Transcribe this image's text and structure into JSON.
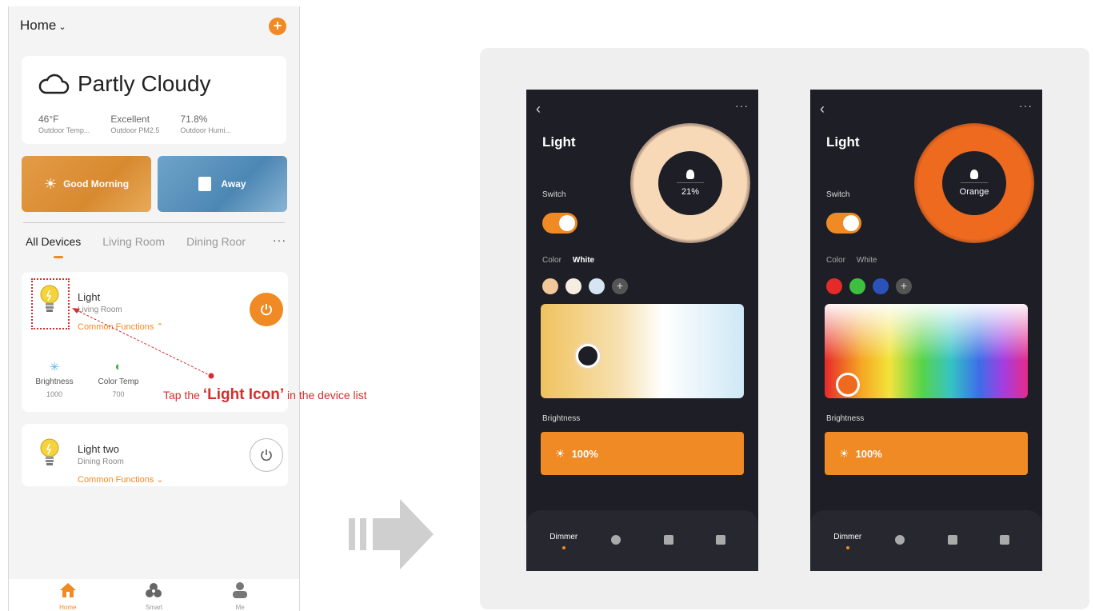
{
  "home": {
    "title": "Home",
    "add_icon": "plus-icon"
  },
  "weather": {
    "condition": "Partly Cloudy",
    "stats": [
      {
        "value": "46°F",
        "label": "Outdoor Temp..."
      },
      {
        "value": "Excellent",
        "label": "Outdoor PM2.5"
      },
      {
        "value": "71.8%",
        "label": "Outdoor Humi..."
      }
    ]
  },
  "scenes": [
    {
      "label": "Good Morning",
      "icon": "sun-icon"
    },
    {
      "label": "Away",
      "icon": "door-icon"
    }
  ],
  "tabs": [
    "All Devices",
    "Living Room",
    "Dining Roor"
  ],
  "tabs_more": "···",
  "devices": [
    {
      "name": "Light",
      "room": "Living Room",
      "functions_label": "Common Functions ⌃",
      "power": "on",
      "functions": [
        {
          "label": "Brightness",
          "value": "1000",
          "icon": "brightness-icon"
        },
        {
          "label": "Color Temp",
          "value": "700",
          "icon": "color-temp-icon"
        }
      ]
    },
    {
      "name": "Light two",
      "room": "Dining Room",
      "functions_label": "Common Functions ⌄",
      "power": "off"
    }
  ],
  "annotation": {
    "prefix": "Tap the ",
    "highlight": "‘Light Icon’",
    "suffix": " in the device list"
  },
  "bottom_nav": [
    {
      "label": "Home",
      "icon": "home-icon",
      "active": true
    },
    {
      "label": "Smart",
      "icon": "smart-icon",
      "active": false
    },
    {
      "label": "Me",
      "icon": "user-icon",
      "active": false
    }
  ],
  "detail_screens": [
    {
      "title": "Light",
      "switch_label": "Switch",
      "ring_value": "21%",
      "ring_color": "#f7d9b8",
      "color_tab": "Color",
      "white_tab": "White",
      "active_tab": "White",
      "swatches": [
        "#f2c79a",
        "#f5ece2",
        "#d6e4f3"
      ],
      "brightness_label": "Brightness",
      "brightness_value": "100%",
      "nav": [
        "Dimmer"
      ]
    },
    {
      "title": "Light",
      "switch_label": "Switch",
      "ring_value": "Orange",
      "ring_color": "#ee6a1f",
      "color_tab": "Color",
      "white_tab": "White",
      "active_tab": "Color",
      "swatches": [
        "#e52a2a",
        "#3fbf3f",
        "#2b52b8"
      ],
      "brightness_label": "Brightness",
      "brightness_value": "100%",
      "nav": [
        "Dimmer"
      ]
    }
  ],
  "colors": {
    "accent": "#f08a24",
    "annotation": "#d62e2e",
    "detail_bg": "#1d1e26"
  }
}
